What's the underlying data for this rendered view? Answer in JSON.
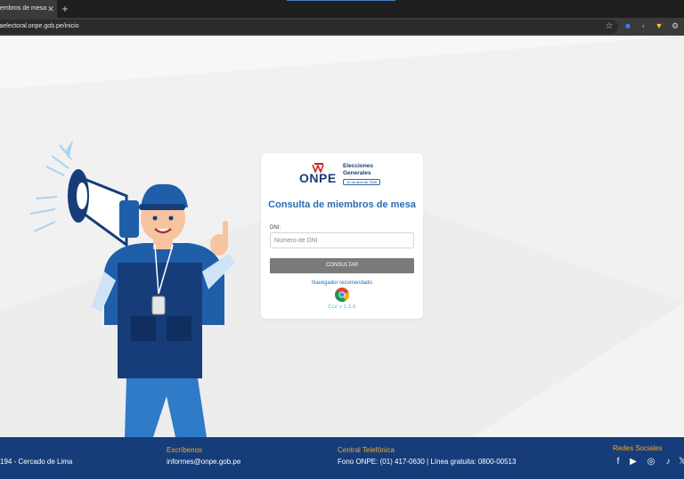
{
  "browser": {
    "tab_title": "embros de mesa",
    "tab_close": "✕",
    "new_tab": "+",
    "url": "ltaelectoral.onpe.gob.pe/inicio",
    "star_icon": "☆"
  },
  "card": {
    "logo_text": "ONPE",
    "logo_elecciones": "Elecciones",
    "logo_generales": "Generales",
    "logo_date": "12 de abril de 2026",
    "title": "Consulta de miembros de mesa",
    "dni_label": "DNI:",
    "dni_placeholder": "Número de DNI",
    "dni_value": "",
    "button_label": "CONSULTAR",
    "recommended_label": "Navegador recomendado",
    "version": "CLV v 1.3.0"
  },
  "footer": {
    "address": "194 - Cercado de Lima",
    "write_heading": "Escríbenos",
    "email": "informes@onpe.gob.pe",
    "phone_heading": "Central Telefónica",
    "phone_text": "Fono ONPE: (01) 417-0630 | Línea gratuita: 0800-00513",
    "social_heading": "Redes Sociales",
    "social_icons": [
      "facebook-icon",
      "youtube-icon",
      "instagram-icon",
      "tiktok-icon",
      "x-icon"
    ]
  },
  "colors": {
    "brand_blue": "#163d7a",
    "title_blue": "#2a6cb4",
    "footer_heading": "#f5a623",
    "button_gray": "#7a7a7a"
  }
}
